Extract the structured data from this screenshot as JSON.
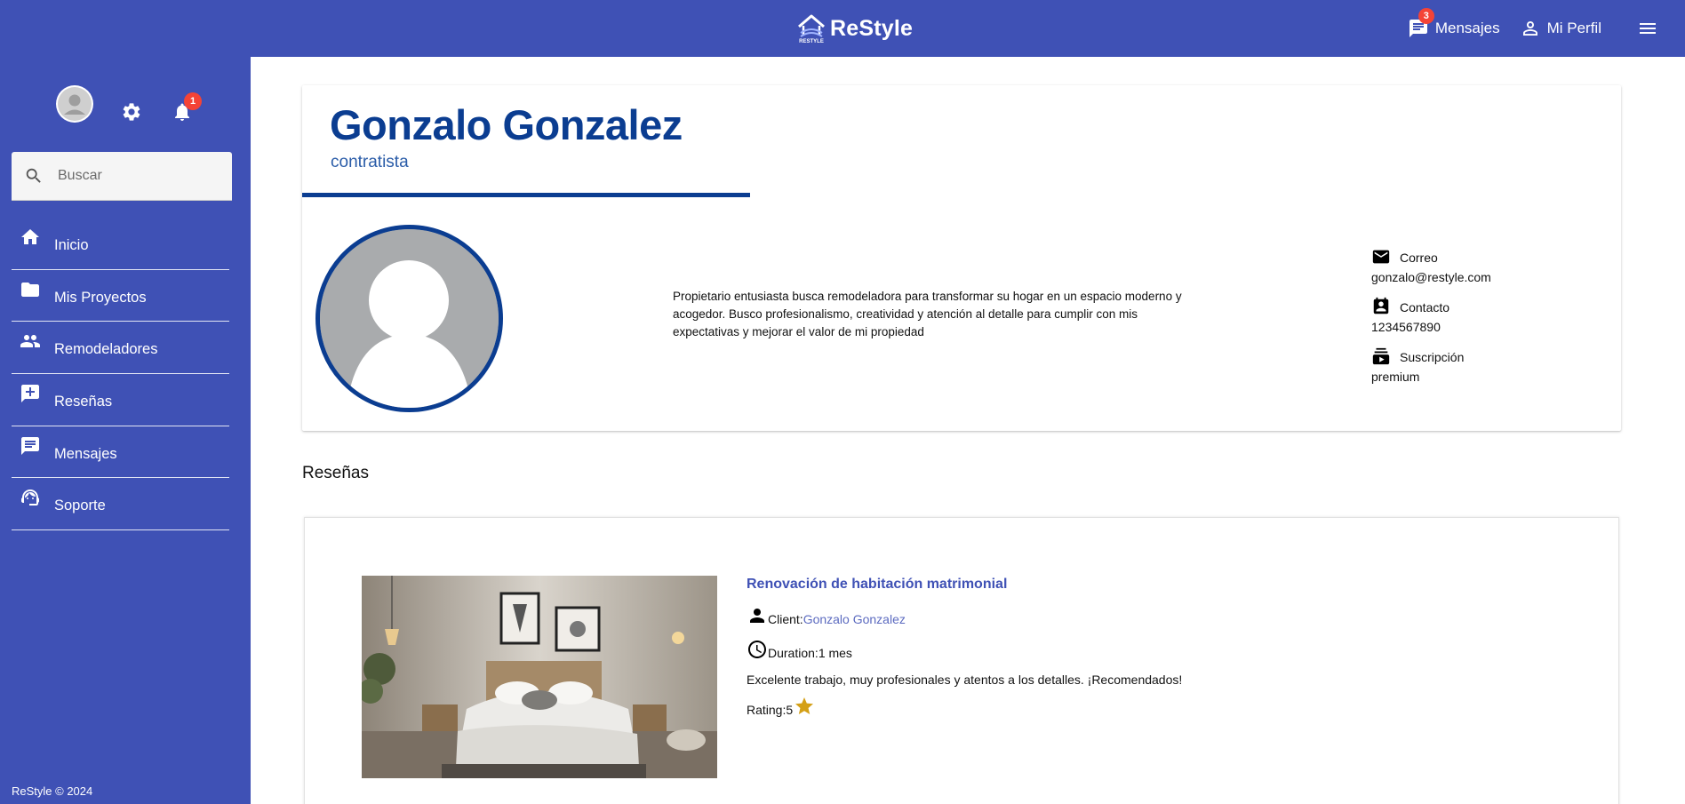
{
  "brand": {
    "name": "ReStyle",
    "logo_tag": "RESTYLE"
  },
  "topbar": {
    "messages_label": "Mensajes",
    "messages_badge": "3",
    "profile_label": "Mi Perfil"
  },
  "sidebar": {
    "notifications_badge": "1",
    "search_placeholder": "Buscar",
    "items": [
      {
        "label": "Inicio",
        "icon": "home-icon"
      },
      {
        "label": "Mis Proyectos",
        "icon": "folder-icon"
      },
      {
        "label": "Remodeladores",
        "icon": "people-icon"
      },
      {
        "label": "Reseñas",
        "icon": "rate-review-icon"
      },
      {
        "label": "Mensajes",
        "icon": "chat-icon"
      },
      {
        "label": "Soporte",
        "icon": "support-agent-icon"
      }
    ],
    "footer": "ReStyle © 2024"
  },
  "profile": {
    "name": "Gonzalo Gonzalez",
    "role": "contratista",
    "bio": "Propietario entusiasta busca remodeladora para transformar su hogar en un espacio moderno y acogedor. Busco profesionalismo, creatividad y atención al detalle para cumplir con mis expectativas y mejorar el valor de mi propiedad",
    "email_label": "Correo",
    "email": "gonzalo@restyle.com",
    "contact_label": "Contacto",
    "contact": "1234567890",
    "subscription_label": "Suscripción",
    "subscription": "premium"
  },
  "reviews": {
    "section_title": "Reseñas",
    "items": [
      {
        "title": "Renovación de habitación matrimonial",
        "client_label": "Client:",
        "client": "Gonzalo Gonzalez",
        "duration_label": "Duration: ",
        "duration": "1 mes",
        "text": "Excelente trabajo, muy profesionales y atentos a los detalles. ¡Recomendados!",
        "rating_label": "Rating: ",
        "rating": "5"
      }
    ]
  },
  "colors": {
    "primary": "#3f51b5",
    "navy": "#0b3d91",
    "badge": "#f44336",
    "star": "#d4a017"
  }
}
